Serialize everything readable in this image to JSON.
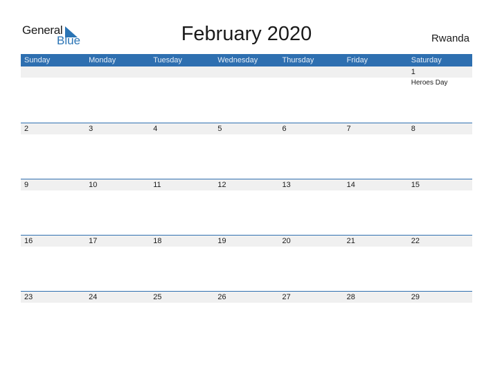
{
  "logo": {
    "general": "General",
    "blue": "Blue",
    "icon": "triangle-flag-icon"
  },
  "title": "February 2020",
  "country": "Rwanda",
  "colors": {
    "header": "#2e6fb0",
    "band": "#f0f0f0",
    "accent": "#2a74b5"
  },
  "weekdays": [
    "Sunday",
    "Monday",
    "Tuesday",
    "Wednesday",
    "Thursday",
    "Friday",
    "Saturday"
  ],
  "weeks": [
    [
      {
        "day": "",
        "event": ""
      },
      {
        "day": "",
        "event": ""
      },
      {
        "day": "",
        "event": ""
      },
      {
        "day": "",
        "event": ""
      },
      {
        "day": "",
        "event": ""
      },
      {
        "day": "",
        "event": ""
      },
      {
        "day": "1",
        "event": "Heroes Day"
      }
    ],
    [
      {
        "day": "2",
        "event": ""
      },
      {
        "day": "3",
        "event": ""
      },
      {
        "day": "4",
        "event": ""
      },
      {
        "day": "5",
        "event": ""
      },
      {
        "day": "6",
        "event": ""
      },
      {
        "day": "7",
        "event": ""
      },
      {
        "day": "8",
        "event": ""
      }
    ],
    [
      {
        "day": "9",
        "event": ""
      },
      {
        "day": "10",
        "event": ""
      },
      {
        "day": "11",
        "event": ""
      },
      {
        "day": "12",
        "event": ""
      },
      {
        "day": "13",
        "event": ""
      },
      {
        "day": "14",
        "event": ""
      },
      {
        "day": "15",
        "event": ""
      }
    ],
    [
      {
        "day": "16",
        "event": ""
      },
      {
        "day": "17",
        "event": ""
      },
      {
        "day": "18",
        "event": ""
      },
      {
        "day": "19",
        "event": ""
      },
      {
        "day": "20",
        "event": ""
      },
      {
        "day": "21",
        "event": ""
      },
      {
        "day": "22",
        "event": ""
      }
    ],
    [
      {
        "day": "23",
        "event": ""
      },
      {
        "day": "24",
        "event": ""
      },
      {
        "day": "25",
        "event": ""
      },
      {
        "day": "26",
        "event": ""
      },
      {
        "day": "27",
        "event": ""
      },
      {
        "day": "28",
        "event": ""
      },
      {
        "day": "29",
        "event": ""
      }
    ]
  ]
}
